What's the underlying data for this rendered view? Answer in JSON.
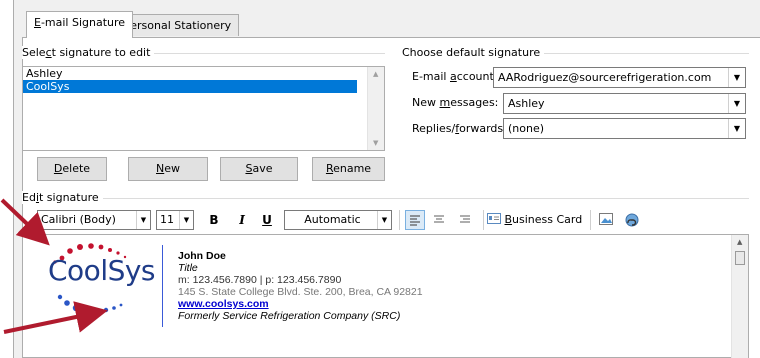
{
  "tabs": [
    {
      "label_pre": "",
      "label_u": "E",
      "label_post": "-mail Signature"
    },
    {
      "label_pre": "",
      "label_u": "P",
      "label_post": "ersonal Stationery"
    }
  ],
  "select_section": {
    "label_pre": "Sele",
    "label_u": "c",
    "label_post": "t signature to edit"
  },
  "signatures": [
    "Ashley",
    "CoolSys"
  ],
  "buttons": {
    "delete": {
      "pre": "",
      "u": "D",
      "post": "elete"
    },
    "new": {
      "pre": "",
      "u": "N",
      "post": "ew"
    },
    "save": {
      "pre": "",
      "u": "S",
      "post": "ave"
    },
    "rename": {
      "pre": "",
      "u": "R",
      "post": "ename"
    }
  },
  "default_section": {
    "title": "Choose default signature",
    "email_account_label_pre": "E-mail ",
    "email_account_label_u": "a",
    "email_account_label_post": "ccount:",
    "email_account_value": "AARodriguez@sourcerefrigeration.com",
    "new_messages_label_pre": "New ",
    "new_messages_label_u": "m",
    "new_messages_label_post": "essages:",
    "new_messages_value": "Ashley",
    "replies_label_pre": "Replies/",
    "replies_label_u": "f",
    "replies_label_post": "orwards:",
    "replies_value": "(none)"
  },
  "edit_section": {
    "label_pre": "Ed",
    "label_u": "i",
    "label_post": "t signature"
  },
  "toolbar": {
    "font": "Calibri (Body)",
    "size": "11",
    "bold": "B",
    "italic": "I",
    "underline": "U",
    "color": "Automatic",
    "business_card_pre": "",
    "business_card_u": "B",
    "business_card_post": "usiness Card"
  },
  "signature": {
    "logo": "CoolSys",
    "name": "John Doe",
    "title": "Title",
    "phones": "m: 123.456.7890 | p: 123.456.7890",
    "address": "145 S. State College Blvd. Ste. 200, Brea, CA 92821",
    "website": "www.coolsys.com",
    "former": "Formerly Service Refrigeration Company (SRC)"
  },
  "colors": {
    "selection": "#0078d7",
    "logo_blue": "#1f3c88",
    "logo_red": "#c4122f",
    "arrow": "#b01b2e",
    "link": "#0000d0"
  }
}
